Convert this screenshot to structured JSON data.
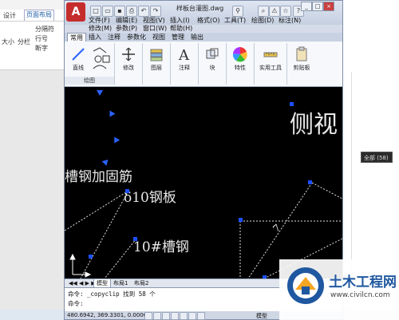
{
  "word": {
    "tabs": [
      "设计",
      "页面布局"
    ],
    "buttons": [
      "大小",
      "分栏",
      "分隔符",
      "行号",
      "断字"
    ]
  },
  "cad": {
    "doc_title": "样板台灌图.dwg",
    "app_letter": "A",
    "menu": [
      "文件(F)",
      "编辑(E)",
      "视图(V)",
      "插入(I)",
      "格式(O)",
      "工具(T)",
      "绘图(D)",
      "标注(N)",
      "修改(M)",
      "参数(P)",
      "窗口(W)",
      "帮助(H)"
    ],
    "ribbon_tabs": [
      "常用",
      "插入",
      "注释",
      "参数化",
      "视图",
      "管理",
      "输出"
    ],
    "ribbon_buttons": [
      "直线",
      "修改",
      "图层",
      "注释",
      "块",
      "特性",
      "实用工具",
      "剪贴板"
    ],
    "group_label": "绘图",
    "drawing_texts": [
      "侧视",
      "槽钢加固筋",
      "δ10钢板",
      "10#槽钢",
      "7"
    ],
    "layout_tabs": [
      "模型",
      "布局1",
      "布局2"
    ],
    "command_lines": [
      "命令: _copyclip 找到 58 个",
      "命令:"
    ],
    "coordinates": "480.6942, 369.3301, 0.0000",
    "status_model": "模型"
  },
  "selection_popup": "全部 (58)",
  "watermark": {
    "title": "土木工程网",
    "url": "www.civilcn.com"
  },
  "colors": {
    "canvas": "#000000",
    "grip": "#1c4fff",
    "brand": "#1f58a0"
  }
}
